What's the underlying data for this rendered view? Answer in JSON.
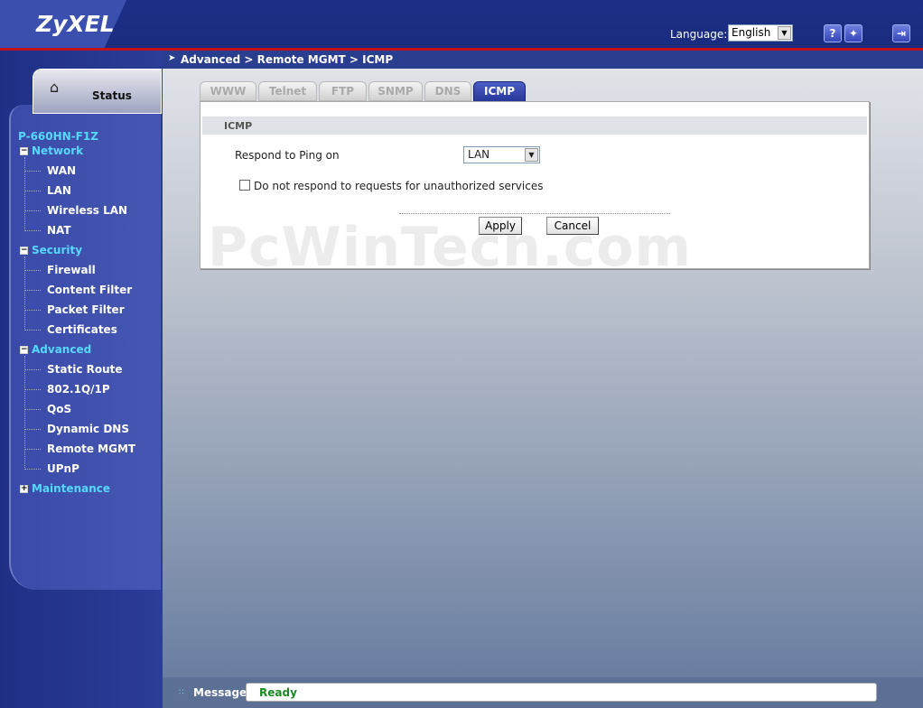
{
  "header": {
    "brand": "ZyXEL",
    "language_label": "Language:",
    "language_value": "English",
    "help_icon": "?",
    "wizard_icon": "wizard-icon",
    "logout_icon": "logout-icon"
  },
  "sidebar": {
    "status_tab": "Status",
    "device": "P-660HN-F1Z",
    "groups": [
      {
        "label": "Network",
        "expanded": true,
        "items": [
          "WAN",
          "LAN",
          "Wireless LAN",
          "NAT"
        ]
      },
      {
        "label": "Security",
        "expanded": true,
        "items": [
          "Firewall",
          "Content Filter",
          "Packet Filter",
          "Certificates"
        ]
      },
      {
        "label": "Advanced",
        "expanded": true,
        "items": [
          "Static Route",
          "802.1Q/1P",
          "QoS",
          "Dynamic DNS",
          "Remote MGMT",
          "UPnP"
        ]
      },
      {
        "label": "Maintenance",
        "expanded": false,
        "items": []
      }
    ]
  },
  "main": {
    "breadcrumb": "Advanced > Remote MGMT > ICMP",
    "tabs": [
      "WWW",
      "Telnet",
      "FTP",
      "SNMP",
      "DNS",
      "ICMP"
    ],
    "active_tab": "ICMP",
    "section_title": "ICMP",
    "ping_label": "Respond to Ping on",
    "ping_value": "LAN",
    "unauth_label": "Do not respond to requests for unauthorized services",
    "unauth_checked": false,
    "apply_label": "Apply",
    "cancel_label": "Cancel",
    "watermark": "PcWinTech.com"
  },
  "footer": {
    "message_label": "Message",
    "message_text": "Ready"
  },
  "colors": {
    "header_bg": "#1c2f87",
    "accent_red": "#c1121c",
    "nav_group": "#56d9ff",
    "ready_green": "#1a8a22"
  }
}
